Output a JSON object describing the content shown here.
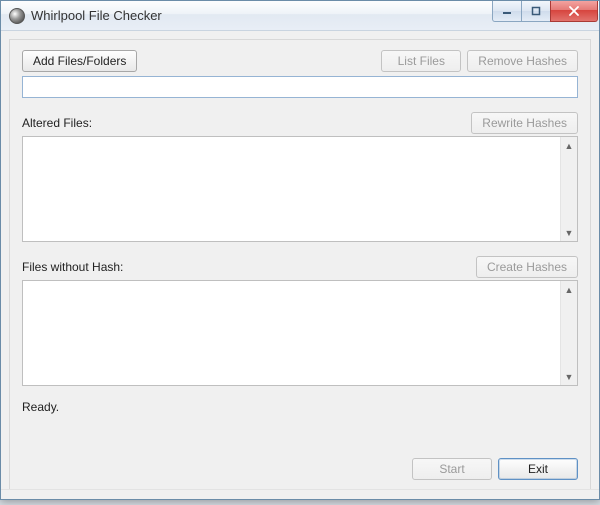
{
  "window": {
    "title": "Whirlpool File Checker"
  },
  "buttons": {
    "add": "Add Files/Folders",
    "list": "List Files",
    "remove": "Remove Hashes",
    "rewrite": "Rewrite Hashes",
    "create": "Create Hashes",
    "start": "Start",
    "exit": "Exit"
  },
  "labels": {
    "altered": "Altered Files:",
    "without": "Files without Hash:"
  },
  "fields": {
    "path_value": "",
    "altered_value": "",
    "without_value": ""
  },
  "status": {
    "text": "Ready."
  }
}
